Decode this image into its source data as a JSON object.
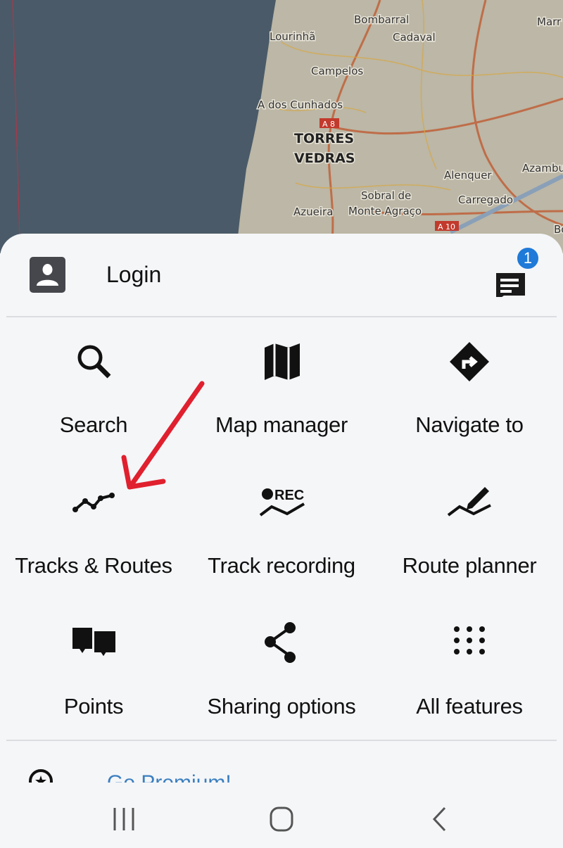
{
  "map": {
    "labels": [
      "Bombarral",
      "Cadaval",
      "Lourinhã",
      "Campelos",
      "A dos Cunhados",
      "A 8",
      "TORRES",
      "VEDRAS",
      "Alenquer",
      "Sobral de",
      "Monte Agraço",
      "Azueira",
      "Carregado",
      "A 10",
      "Azambu",
      "Marr",
      "Bo"
    ]
  },
  "header": {
    "login_label": "Login",
    "notification_count": "1"
  },
  "menu": {
    "items": [
      {
        "label": "Search",
        "icon": "search-icon"
      },
      {
        "label": "Map manager",
        "icon": "map-icon"
      },
      {
        "label": "Navigate to",
        "icon": "navigate-icon"
      },
      {
        "label": "Tracks & Routes",
        "icon": "tracks-icon"
      },
      {
        "label": "Track recording",
        "icon": "record-icon",
        "badge": "REC"
      },
      {
        "label": "Route planner",
        "icon": "route-planner-icon"
      },
      {
        "label": "Points",
        "icon": "points-icon"
      },
      {
        "label": "Sharing options",
        "icon": "share-icon"
      },
      {
        "label": "All features",
        "icon": "grid-icon"
      }
    ]
  },
  "premium": {
    "label": "Go Premium!"
  },
  "colors": {
    "accent": "#1f7ad8",
    "arrow": "#e0202e",
    "sea": "#4a5a68",
    "land": "#bdb8a8"
  }
}
